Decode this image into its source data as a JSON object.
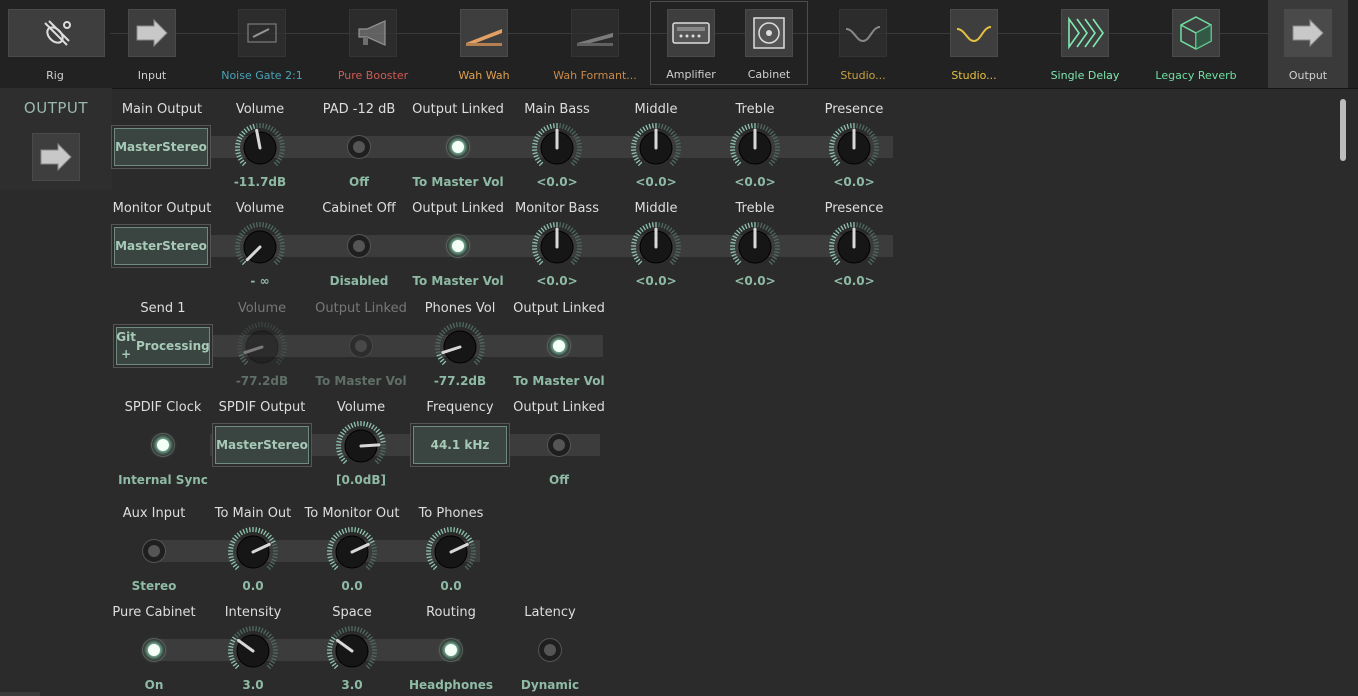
{
  "chain": [
    {
      "label": "Rig",
      "color": "#d0d0d0",
      "icon": "guitar-off-icon"
    },
    {
      "label": "Input",
      "color": "#d0d0d0",
      "icon": "arrow-right-icon"
    },
    {
      "label": "Noise Gate 2:1",
      "color": "#4aa3b8",
      "icon": "switch-icon",
      "dim": true
    },
    {
      "label": "Pure Booster",
      "color": "#d05a55",
      "icon": "megaphone-icon",
      "dim": true
    },
    {
      "label": "Wah Wah",
      "color": "#e0a050",
      "icon": "pedal-icon"
    },
    {
      "label": "Wah Formant...",
      "color": "#c88a48",
      "icon": "pedal-icon",
      "dim": true
    },
    {
      "label": "Amplifier",
      "color": "#d0d0d0",
      "icon": "amplifier-icon"
    },
    {
      "label": "Cabinet",
      "color": "#d0d0d0",
      "icon": "speaker-icon"
    },
    {
      "label": "Studio...",
      "color": "#c8a040",
      "icon": "eq-curve-icon",
      "dim": true
    },
    {
      "label": "Studio...",
      "color": "#e6c040",
      "icon": "eq-curve-icon"
    },
    {
      "label": "Single Delay",
      "color": "#7fe8b0",
      "icon": "delay-icon"
    },
    {
      "label": "Legacy Reverb",
      "color": "#6fdfa0",
      "icon": "cube-icon"
    },
    {
      "label": "Output",
      "color": "#d0d0d0",
      "icon": "arrow-right-icon"
    }
  ],
  "side": {
    "title": "OUTPUT",
    "icon": "arrow-right-icon"
  },
  "rows": {
    "r1": {
      "main_output": {
        "label": "Main Output",
        "value": "Master Stereo",
        "line1": "Master",
        "line2": "Stereo"
      },
      "volume": {
        "label": "Volume",
        "value": "-11.7dB",
        "level": 0.46
      },
      "pad": {
        "label": "PAD -12 dB",
        "value": "Off",
        "on": false
      },
      "linked": {
        "label": "Output Linked",
        "value": "To Master Vol",
        "on": true
      },
      "bass": {
        "label": "Main Bass",
        "value": "<0.0>",
        "level": 0.5
      },
      "middle": {
        "label": "Middle",
        "value": "<0.0>",
        "level": 0.5
      },
      "treble": {
        "label": "Treble",
        "value": "<0.0>",
        "level": 0.5
      },
      "presence": {
        "label": "Presence",
        "value": "<0.0>",
        "level": 0.5
      }
    },
    "r2": {
      "monitor_output": {
        "label": "Monitor Output",
        "line1": "Master",
        "line2": "Stereo"
      },
      "volume": {
        "label": "Volume",
        "value": "- ∞",
        "level": 0.0
      },
      "cabinet_off": {
        "label": "Cabinet Off",
        "value": "Disabled",
        "on": false
      },
      "linked": {
        "label": "Output Linked",
        "value": "To Master Vol",
        "on": true
      },
      "bass": {
        "label": "Monitor Bass",
        "value": "<0.0>",
        "level": 0.5
      },
      "middle": {
        "label": "Middle",
        "value": "<0.0>",
        "level": 0.5
      },
      "treble": {
        "label": "Treble",
        "value": "<0.0>",
        "level": 0.5
      },
      "presence": {
        "label": "Presence",
        "value": "<0.0>",
        "level": 0.5
      }
    },
    "r3": {
      "send1": {
        "label": "Send 1",
        "line1": "Git +",
        "line2": "Processing"
      },
      "volume": {
        "label": "Volume",
        "value": "-77.2dB",
        "level": 0.1
      },
      "linked": {
        "label": "Output Linked",
        "value": "To Master Vol",
        "on": false
      },
      "phones_vol": {
        "label": "Phones Vol",
        "value": "-77.2dB",
        "level": 0.1
      },
      "phones_linked": {
        "label": "Output Linked",
        "value": "To Master Vol",
        "on": true
      }
    },
    "r4": {
      "spdif_clock": {
        "label": "SPDIF Clock",
        "value": "Internal Sync",
        "on": true
      },
      "spdif_output": {
        "label": "SPDIF Output",
        "line1": "Master",
        "line2": "Stereo"
      },
      "volume": {
        "label": "Volume",
        "value": "[0.0dB]",
        "level": 0.82
      },
      "frequency": {
        "label": "Frequency",
        "value": "44.1 kHz"
      },
      "linked": {
        "label": "Output Linked",
        "value": "Off",
        "on": false
      }
    },
    "r5": {
      "aux_input": {
        "label": "Aux Input",
        "value": "Stereo",
        "on": false
      },
      "to_main": {
        "label": "To Main Out",
        "value": "0.0",
        "level": 0.74
      },
      "to_monitor": {
        "label": "To Monitor Out",
        "value": "0.0",
        "level": 0.74
      },
      "to_phones": {
        "label": "To Phones",
        "value": "0.0",
        "level": 0.74
      }
    },
    "r6": {
      "pure_cabinet": {
        "label": "Pure Cabinet",
        "value": "On",
        "on": true
      },
      "intensity": {
        "label": "Intensity",
        "value": "3.0",
        "level": 0.3
      },
      "space": {
        "label": "Space",
        "value": "3.0",
        "level": 0.3
      },
      "routing": {
        "label": "Routing",
        "value": "Headphones",
        "on": true
      },
      "latency": {
        "label": "Latency",
        "value": "Dynamic",
        "on": false
      }
    }
  }
}
